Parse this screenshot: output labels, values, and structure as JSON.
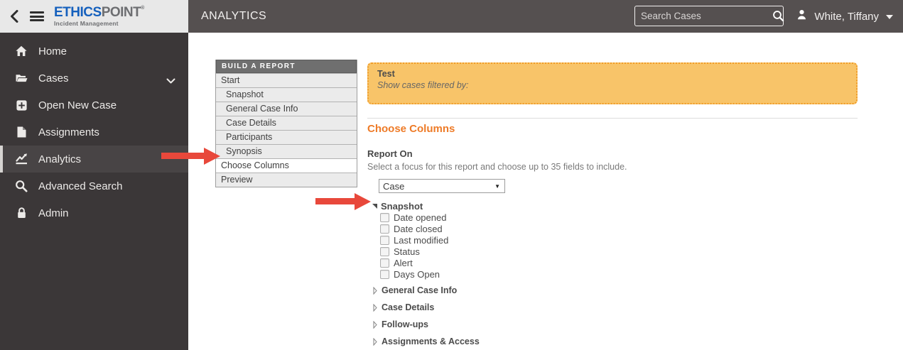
{
  "brand": {
    "logo_primary": "ETHICS",
    "logo_secondary": "POINT",
    "logo_mark": "®",
    "tagline": "Incident Management"
  },
  "topbar": {
    "title": "ANALYTICS",
    "search": {
      "placeholder": "Search Cases"
    },
    "user": {
      "name": "White, Tiffany"
    }
  },
  "sidebar": {
    "items": [
      {
        "label": "Home",
        "icon": "home-icon",
        "active": false
      },
      {
        "label": "Cases",
        "icon": "folder-open-icon",
        "active": false,
        "has_submenu": true
      },
      {
        "label": "Open New Case",
        "icon": "plus-square-icon",
        "active": false
      },
      {
        "label": "Assignments",
        "icon": "file-icon",
        "active": false
      },
      {
        "label": "Analytics",
        "icon": "chart-line-icon",
        "active": true
      },
      {
        "label": "Advanced Search",
        "icon": "search-icon",
        "active": false
      },
      {
        "label": "Admin",
        "icon": "lock-icon",
        "active": false
      }
    ]
  },
  "report_menu": {
    "header": "BUILD A REPORT",
    "items": [
      {
        "label": "Start",
        "indent": false,
        "selected": false
      },
      {
        "label": "Snapshot",
        "indent": true,
        "selected": false
      },
      {
        "label": "General Case Info",
        "indent": true,
        "selected": false
      },
      {
        "label": "Case Details",
        "indent": true,
        "selected": false
      },
      {
        "label": "Participants",
        "indent": true,
        "selected": false
      },
      {
        "label": "Synopsis",
        "indent": true,
        "selected": false
      },
      {
        "label": "Choose Columns",
        "indent": false,
        "selected": true
      },
      {
        "label": "Preview",
        "indent": false,
        "selected": false
      }
    ]
  },
  "content": {
    "report_summary": {
      "title": "Test",
      "filter_line": "Show cases filtered by:"
    },
    "section_heading": "Choose Columns",
    "report_on": {
      "label": "Report On",
      "description": "Select a focus for this report and choose up to 35 fields to include.",
      "selected_option": "Case"
    },
    "field_groups": {
      "expanded": {
        "label": "Snapshot",
        "fields": [
          {
            "label": "Date opened",
            "checked": false
          },
          {
            "label": "Date closed",
            "checked": false
          },
          {
            "label": "Last modified",
            "checked": false
          },
          {
            "label": "Status",
            "checked": false
          },
          {
            "label": "Alert",
            "checked": false
          },
          {
            "label": "Days Open",
            "checked": false
          }
        ]
      },
      "collapsed": [
        {
          "label": "General Case Info"
        },
        {
          "label": "Case Details"
        },
        {
          "label": "Follow-ups"
        },
        {
          "label": "Assignments & Access"
        }
      ]
    }
  },
  "annotations": {
    "arrows": [
      {
        "points_at": "choose-columns-menu-item"
      },
      {
        "points_at": "snapshot-field-group"
      }
    ]
  },
  "icons": {
    "caret_down_glyph": "▼"
  },
  "colors": {
    "topbar_bg": "#555050",
    "sidebar_bg": "#3b3738",
    "sidebar_active_bg": "#484445",
    "logo_blue": "#1560bd",
    "logo_gray": "#6d6e71",
    "heading_orange": "#ee7b28",
    "alert_bg": "#f8c469",
    "alert_border": "#f09c28",
    "arrow_red": "#e8483b",
    "menu_header_bg": "#6f6f6f",
    "menu_item_bg": "#ebebeb"
  }
}
